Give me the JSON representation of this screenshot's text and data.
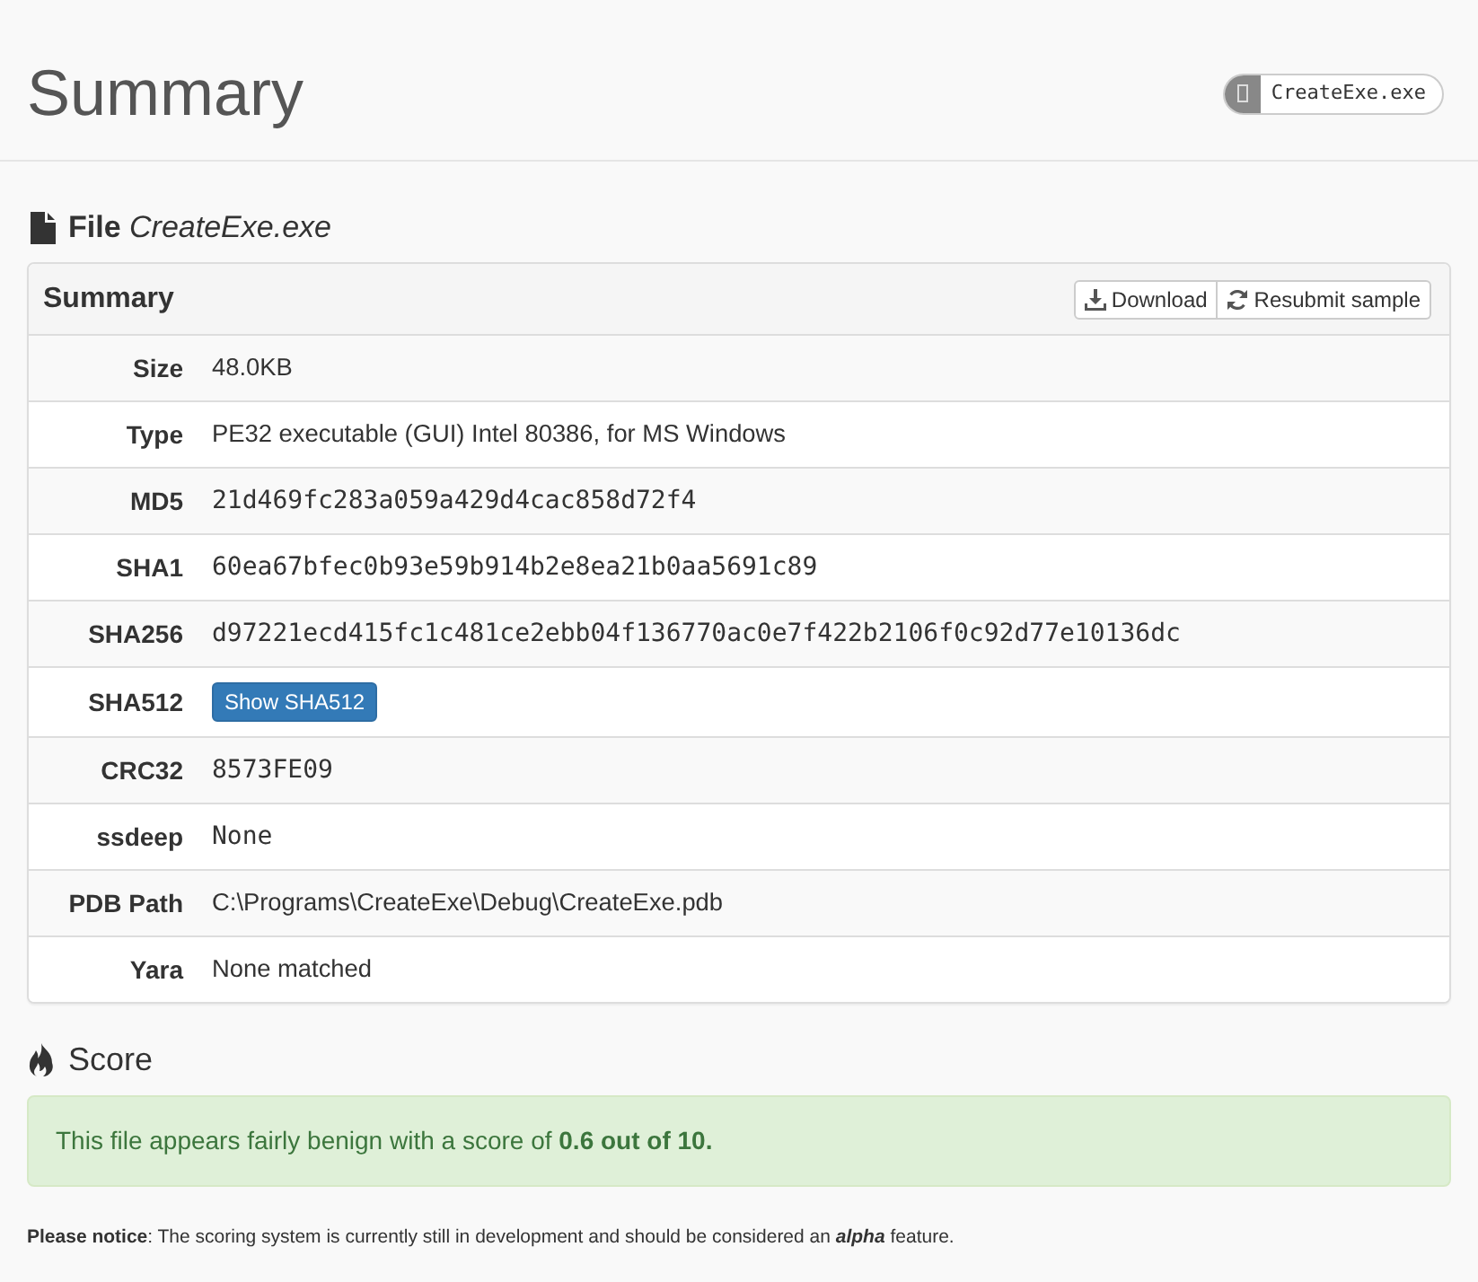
{
  "header": {
    "title": "Summary",
    "badge": "CreateExe.exe"
  },
  "file_section": {
    "heading": "**File** *CreateExe.exe*",
    "panel": {
      "title": "Summary",
      "actions": [
        {
          "kind": "download",
          "label": "Download"
        },
        {
          "kind": "refresh",
          "label": "Resubmit sample"
        }
      ],
      "rows": [
        {
          "label": "Size",
          "kind": "text",
          "value": "48.0KB"
        },
        {
          "label": "Type",
          "kind": "text",
          "value": "PE32 executable (GUI) Intel 80386, for MS Windows"
        },
        {
          "label": "MD5",
          "kind": "mono",
          "value": "21d469fc283a059a429d4cac858d72f4"
        },
        {
          "label": "SHA1",
          "kind": "mono",
          "value": "60ea67bfec0b93e59b914b2e8ea21b0aa5691c89"
        },
        {
          "label": "SHA256",
          "kind": "mono",
          "value": "d97221ecd415fc1c481ce2ebb04f136770ac0e7f422b2106f0c92d77e10136dc"
        },
        {
          "label": "SHA512",
          "kind": "button",
          "value": "Show SHA512"
        },
        {
          "label": "CRC32",
          "kind": "mono",
          "value": "8573FE09"
        },
        {
          "label": "ssdeep",
          "kind": "mono",
          "value": "None"
        },
        {
          "label": "PDB Path",
          "kind": "text",
          "value": "C:\\Programs\\CreateExe\\Debug\\CreateExe.pdb"
        },
        {
          "label": "Yara",
          "kind": "text",
          "value": "None matched"
        }
      ]
    }
  },
  "score_section": {
    "heading": "Score",
    "message": "This file appears fairly benign with a score of **0.6 out of 10.**",
    "notice": "**Please notice**: The scoring system is currently still in development and should be considered an *alpha* feature."
  }
}
